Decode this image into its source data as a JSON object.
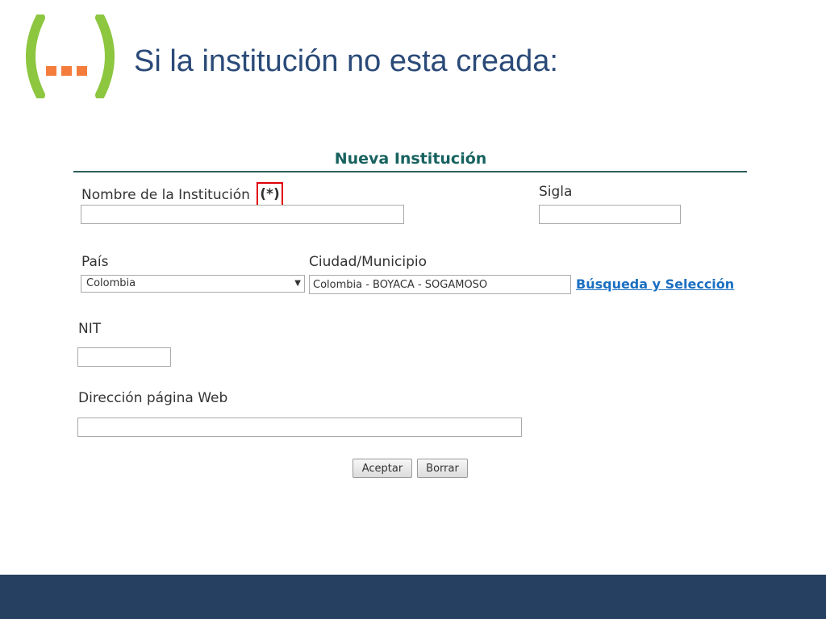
{
  "slide": {
    "title": "Si la institución no esta creada:",
    "logo_text": "(...)"
  },
  "form": {
    "heading": "Nueva Institución",
    "nombre_label": "Nombre de la Institución",
    "required_marker": "(*)",
    "nombre_value": "",
    "sigla_label": "Sigla",
    "sigla_value": "",
    "pais_label": "País",
    "pais_selected": "Colombia",
    "ciudad_label": "Ciudad/Municipio",
    "ciudad_value": "Colombia - BOYACÁ - SOGAMOSO",
    "search_link": "Búsqueda y Selección",
    "nit_label": "NIT",
    "nit_value": "",
    "web_label": "Dirección página Web",
    "web_value": "",
    "accept_button": "Aceptar",
    "clear_button": "Borrar"
  },
  "colors": {
    "title": "#2a4a78",
    "heading": "#17625f",
    "logo_paren": "#8dc63f",
    "logo_dots": "#f47c3c",
    "required_box": "#e0000a",
    "link": "#1a6fc1",
    "footer": "#254061"
  }
}
